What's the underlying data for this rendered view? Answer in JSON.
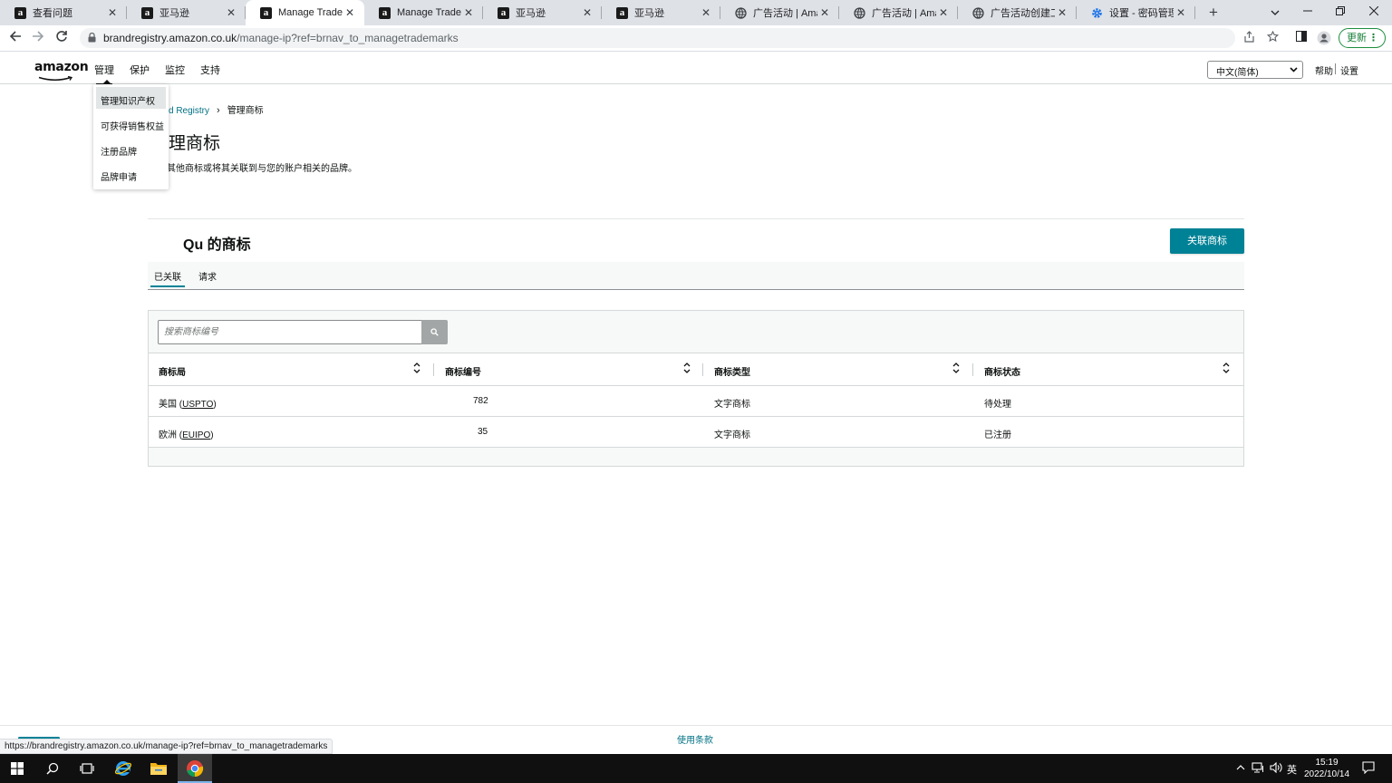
{
  "browser": {
    "tabs": [
      {
        "title": "查看问题",
        "icon": "amazon-favicon",
        "active": false
      },
      {
        "title": "亚马逊",
        "icon": "amazon-favicon",
        "active": false
      },
      {
        "title": "Manage Trademarks",
        "icon": "amazon-favicon",
        "active": true
      },
      {
        "title": "Manage Trademarks",
        "icon": "amazon-favicon",
        "active": false
      },
      {
        "title": "亚马逊",
        "icon": "amazon-favicon",
        "active": false
      },
      {
        "title": "亚马逊",
        "icon": "amazon-favicon",
        "active": false
      },
      {
        "title": "广告活动 | Amazon",
        "icon": "globe-favicon",
        "active": false
      },
      {
        "title": "广告活动 | Amazon",
        "icon": "globe-favicon",
        "active": false
      },
      {
        "title": "广告活动创建工具",
        "icon": "globe-favicon",
        "active": false
      },
      {
        "title": "设置 - 密码管理器",
        "icon": "gear-favicon",
        "active": false
      }
    ],
    "close_glyph": "✕",
    "new_tab_glyph": "+",
    "url_host": "brandregistry.amazon.co.uk",
    "url_path": "/manage-ip?ref=brnav_to_managetrademarks",
    "update_label": "更新",
    "status_url": "https://brandregistry.amazon.co.uk/manage-ip?ref=brnav_to_managetrademarks"
  },
  "header": {
    "logo": "amazon",
    "nav": [
      "管理",
      "保护",
      "监控",
      "支持"
    ],
    "active_nav": "管理",
    "language": "中文(简体)",
    "help": "帮助",
    "settings": "设置"
  },
  "dropdown": {
    "items": [
      "管理知识产权",
      "可获得销售权益",
      "注册品牌",
      "品牌申请"
    ],
    "hovered": "管理知识产权"
  },
  "page": {
    "breadcrumb_parent": "d Registry",
    "breadcrumb_current": "管理商标",
    "title": "理商标",
    "description": "其他商标或将其关联到与您的账户相关的品牌。",
    "section_title": "Qu 的商标",
    "link_button": "关联商标",
    "tabs": [
      "已关联",
      "请求"
    ],
    "active_tab": "已关联",
    "search_placeholder": "搜索商标编号"
  },
  "table": {
    "columns": [
      "商标局",
      "商标编号",
      "商标类型",
      "商标状态"
    ],
    "rows": [
      {
        "office": "美国",
        "office_abbr": "USPTO",
        "number": "782",
        "type": "文字商标",
        "status": "待处理"
      },
      {
        "office": "欧洲",
        "office_abbr": "EUIPO",
        "number": "35",
        "type": "文字商标",
        "status": "已注册"
      }
    ]
  },
  "footer": {
    "terms": "使用条款"
  },
  "taskbar": {
    "ime": "英",
    "time": "15:19",
    "date": "2022/10/14"
  },
  "colors": {
    "accent": "#008296",
    "link": "#007185",
    "update_green": "#188038"
  }
}
